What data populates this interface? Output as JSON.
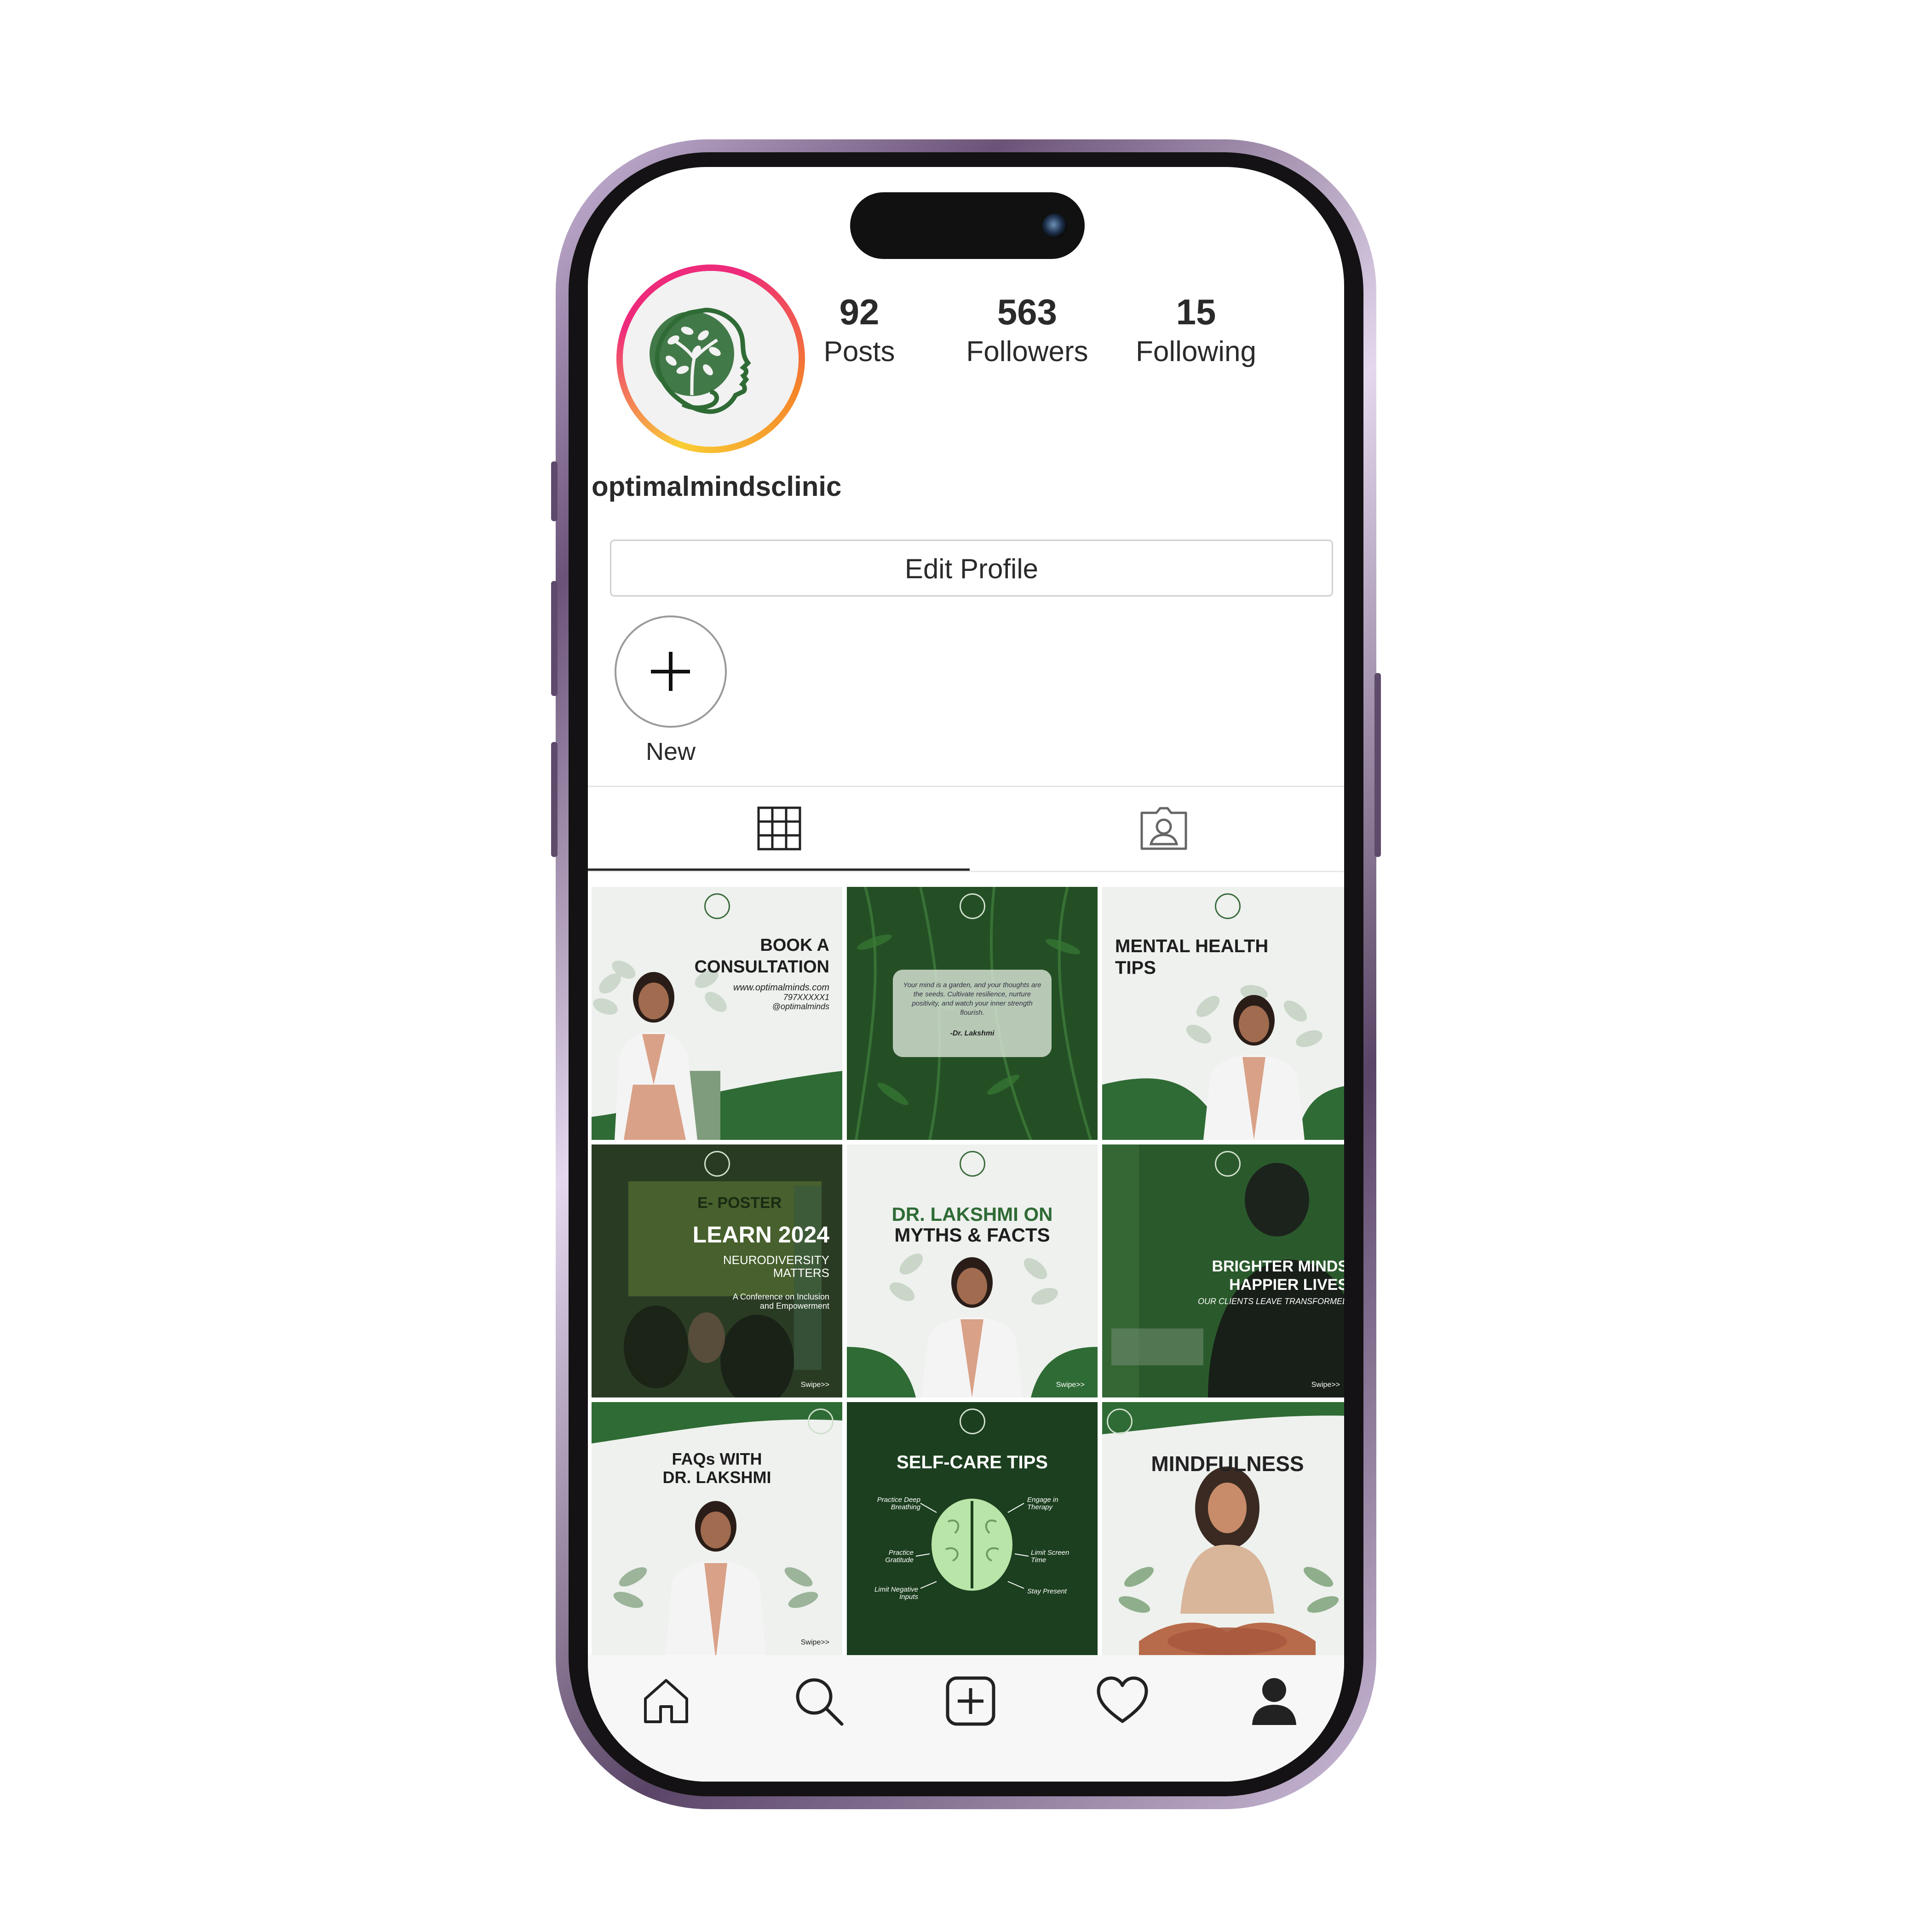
{
  "profile": {
    "username": "optimalmindsclinic",
    "stats": {
      "posts_count": "92",
      "posts_label": "Posts",
      "followers_count": "563",
      "followers_label": "Followers",
      "following_count": "15",
      "following_label": "Following"
    },
    "edit_profile_label": "Edit Profile",
    "new_highlight_label": "New"
  },
  "colors": {
    "brand_green": "#2f6b35",
    "dark_green": "#1f4d24",
    "light_bg": "#eef1ee",
    "text": "#2a2a2a"
  },
  "tabs": [
    {
      "name": "posts-grid",
      "icon": "grid-icon",
      "active": true
    },
    {
      "name": "tagged",
      "icon": "tagged-person-icon",
      "active": false
    }
  ],
  "posts": [
    {
      "title_line1": "BOOK A",
      "title_line2": "CONSULTATION",
      "detail1": "www.optimalminds.com",
      "detail2": "797XXXXX1",
      "detail3": "@optimalminds"
    },
    {
      "quote": "Your mind is a garden, and your thoughts are the seeds. Cultivate resilience, nurture positivity, and watch your inner strength flourish.",
      "author": "-Dr. Lakshmi"
    },
    {
      "title_line1": "MENTAL HEALTH",
      "title_line2": "TIPS"
    },
    {
      "kicker": "E- POSTER",
      "title": "LEARN 2024",
      "sub1": "NEURODIVERSITY",
      "sub2": "MATTERS",
      "sub3": "A Conference on Inclusion",
      "sub4": "and Empowerment",
      "swipe": "Swipe>>"
    },
    {
      "title_line1": "DR. LAKSHMI ON",
      "title_line2": "MYTHS & FACTS",
      "swipe": "Swipe>>"
    },
    {
      "title_line1": "BRIGHTER MINDS",
      "title_line2": "HAPPIER LIVES",
      "sub": "OUR CLIENTS LEAVE TRANSFORMED",
      "swipe": "Swipe>>"
    },
    {
      "title_line1": "FAQs WITH",
      "title_line2": "DR. LAKSHMI",
      "swipe": "Swipe>>"
    },
    {
      "title": "SELF-CARE TIPS",
      "tip1": "Practice Deep Breathing",
      "tip2": "Engage in Therapy",
      "tip3": "Practice Gratitude",
      "tip4": "Limit Screen Time",
      "tip5": "Limit Negative Inputs",
      "tip6": "Stay Present"
    },
    {
      "title": "MINDFULNESS"
    }
  ],
  "bottom_nav": [
    {
      "icon": "home-icon"
    },
    {
      "icon": "search-icon"
    },
    {
      "icon": "add-post-icon"
    },
    {
      "icon": "heart-icon"
    },
    {
      "icon": "profile-icon"
    }
  ]
}
